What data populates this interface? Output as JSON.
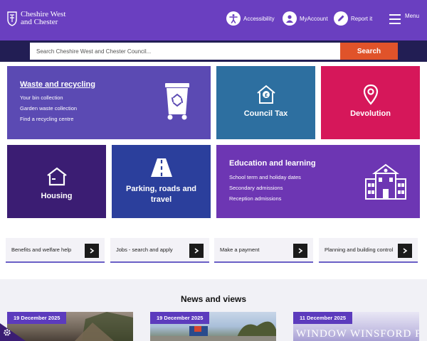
{
  "header": {
    "logo_line1": "Cheshire West",
    "logo_line2": "and Chester",
    "nav": {
      "accessibility": "Accessibility",
      "myaccount": "MyAccount",
      "report": "Report it",
      "menu": "Menu"
    }
  },
  "search": {
    "placeholder": "Search Cheshire West and Chester Council...",
    "button": "Search"
  },
  "tiles": {
    "waste": {
      "title": "Waste and recycling",
      "links": [
        "Your bin collection",
        "Garden waste collection",
        "Find a recycling centre"
      ]
    },
    "council_tax": {
      "title": "Council Tax"
    },
    "devolution": {
      "title": "Devolution"
    },
    "housing": {
      "title": "Housing"
    },
    "parking": {
      "title": "Parking, roads and travel"
    },
    "education": {
      "title": "Education and learning",
      "links": [
        "School term and holiday dates",
        "Secondary admissions",
        "Reception admissions"
      ]
    }
  },
  "quick_links": [
    {
      "label": "Benefits and welfare help"
    },
    {
      "label": "Jobs - search and apply"
    },
    {
      "label": "Make a payment"
    },
    {
      "label": "Planning and building control"
    }
  ],
  "news": {
    "title": "News and views",
    "cards": [
      {
        "date": "19 December 2025"
      },
      {
        "date": "19 December 2025"
      },
      {
        "date": "11 December 2025",
        "image_text": "WINDOW WINSFORD PRESI"
      }
    ]
  },
  "colors": {
    "header": "#6a3fc0",
    "search_band": "#221e54",
    "search_button": "#e0532a",
    "accent": "#5c3bbd"
  }
}
